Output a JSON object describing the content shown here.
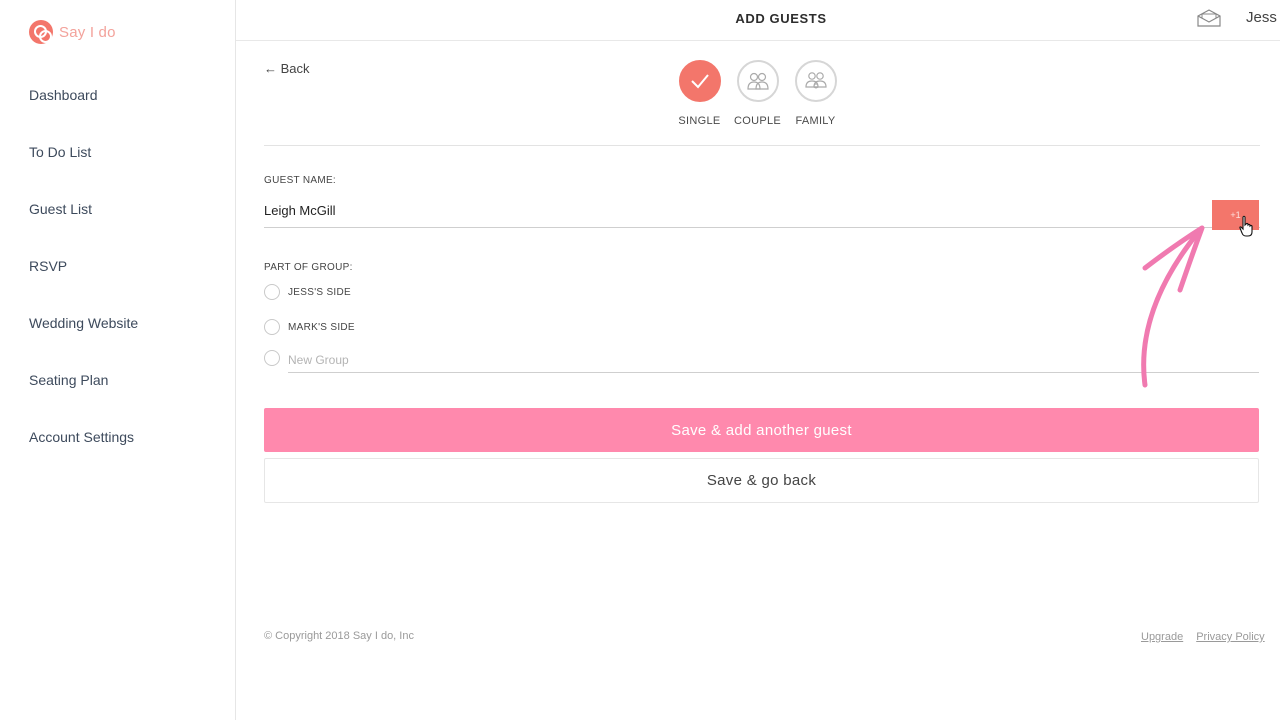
{
  "brand": {
    "name": "Say I do",
    "accent_color": "#f3766b",
    "primary_button_color": "#ff89ad"
  },
  "sidebar": {
    "items": [
      {
        "label": "Dashboard"
      },
      {
        "label": "To Do List"
      },
      {
        "label": "Guest List"
      },
      {
        "label": "RSVP"
      },
      {
        "label": "Wedding Website"
      },
      {
        "label": "Seating Plan"
      },
      {
        "label": "Account Settings"
      }
    ]
  },
  "header": {
    "title": "ADD GUESTS",
    "user_name": "Jess",
    "icons": [
      "envelope-icon"
    ]
  },
  "main": {
    "back_label": "← Back",
    "steps": [
      {
        "label": "SINGLE",
        "icon": "check-icon",
        "active": true
      },
      {
        "label": "COUPLE",
        "icon": "couple-icon",
        "active": false
      },
      {
        "label": "FAMILY",
        "icon": "family-icon",
        "active": false
      }
    ],
    "guest_name_label": "GUEST NAME:",
    "guest_name_value": "Leigh McGill",
    "plus_one_label": "+1",
    "group_label": "PART OF GROUP:",
    "groups": [
      {
        "label": "JESS'S SIDE"
      },
      {
        "label": "MARK'S SIDE"
      }
    ],
    "new_group_placeholder": "New Group",
    "save_add_label": "Save & add another guest",
    "save_back_label": "Save & go back"
  },
  "footer": {
    "copyright": "© Copyright 2018 Say I do, Inc",
    "links": [
      {
        "label": "Upgrade"
      },
      {
        "label": "Privacy Policy"
      }
    ]
  }
}
